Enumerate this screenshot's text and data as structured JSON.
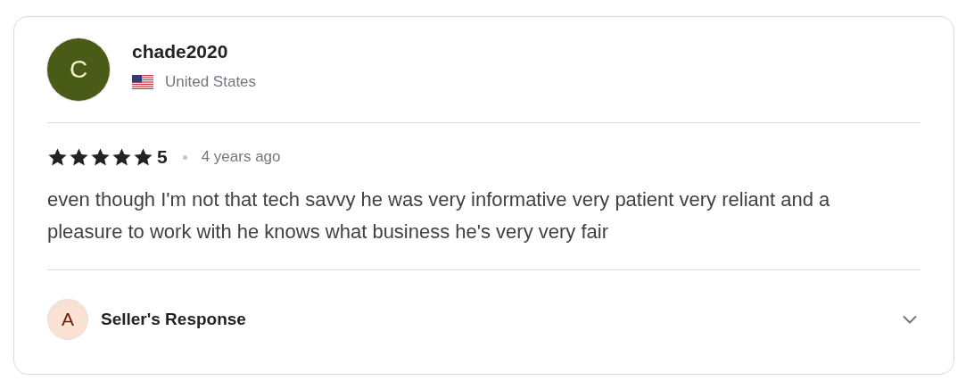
{
  "review": {
    "avatar_letter": "C",
    "color": "#4a5a17",
    "username": "chade2020",
    "country": "United States",
    "stars": 5,
    "rating": "5",
    "time": "4 years ago",
    "text": "even though I'm not that tech savvy he was very informative very patient very reliant and a pleasure to work with he knows what business he's very very fair"
  },
  "seller_response": {
    "avatar_letter": "A",
    "label": "Seller's Response",
    "expanded": false
  }
}
